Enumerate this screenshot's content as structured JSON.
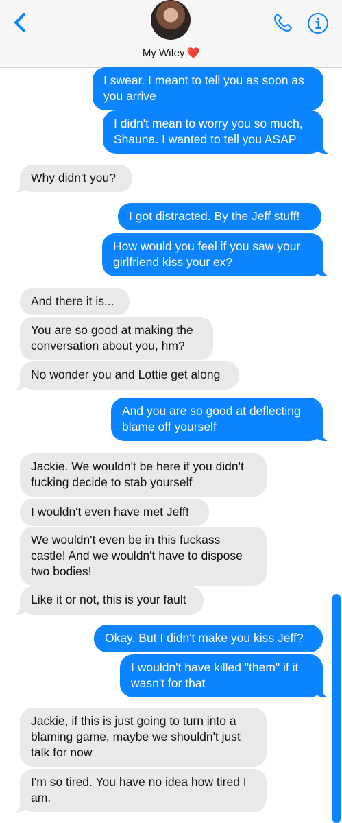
{
  "header": {
    "contact_name": "My Wifey",
    "heart": "❤️"
  },
  "messages": [
    {
      "dir": "out",
      "text": "I swear. I meant to tell you as soon as\nyou arrive"
    },
    {
      "dir": "out",
      "text": "I didn't mean to worry you so much,\nShauna. I wanted to tell you ASAP"
    },
    {
      "dir": "in",
      "text": "Why didn't you?"
    },
    {
      "dir": "out",
      "text": "I got distracted. By the Jeff stuff!"
    },
    {
      "dir": "out",
      "text": "How would you feel if you saw your\ngirlfriend kiss your ex?"
    },
    {
      "dir": "in",
      "text": "And there it is..."
    },
    {
      "dir": "in",
      "text": "You are so good at making the\nconversation about you, hm?"
    },
    {
      "dir": "in",
      "text": "No wonder you and Lottie get along"
    },
    {
      "dir": "out",
      "text": "And you are so good at deflecting\nblame off yourself"
    },
    {
      "dir": "in",
      "text": "Jackie. We wouldn't be here if you didn't\nfucking decide to stab yourself"
    },
    {
      "dir": "in",
      "text": "I wouldn't even have met Jeff!"
    },
    {
      "dir": "in",
      "text": "We wouldn't even be in this fuckass\ncastle! And we wouldn't have to dispose\ntwo bodies!"
    },
    {
      "dir": "in",
      "text": "Like it or not, this is your fault"
    },
    {
      "dir": "out",
      "text": "Okay. But I didn't make you kiss Jeff?"
    },
    {
      "dir": "out",
      "text": "I wouldn't have killed \"them\" if it\nwasn't for that"
    },
    {
      "dir": "in",
      "text": "Jackie, if this is just going to turn into a\nblaming game, maybe we shouldn't just\ntalk for now"
    },
    {
      "dir": "in",
      "text": "I'm so tired. You have no idea how tired I\nam."
    }
  ]
}
